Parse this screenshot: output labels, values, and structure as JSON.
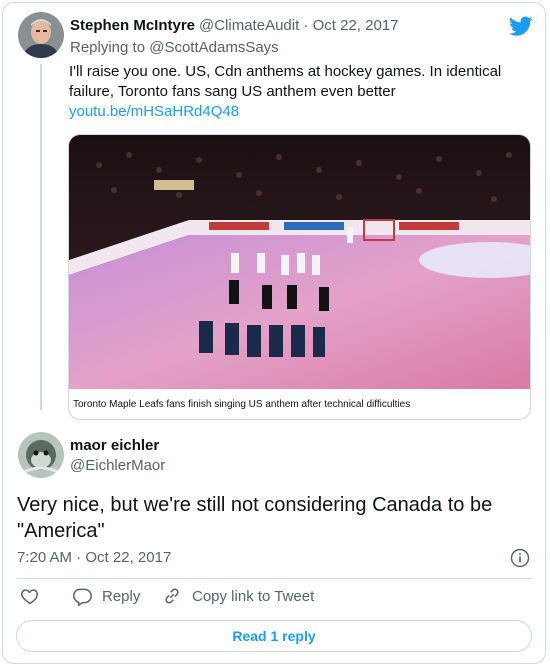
{
  "quoted_tweet": {
    "author_name": "Stephen McIntyre",
    "handle": "@ClimateAudit",
    "separator": "·",
    "date": "Oct 22, 2017",
    "reply_prefix": "Replying to",
    "reply_to": "@ScottAdamsSays",
    "text_line1": "I'll raise you one. US, Cdn anthems at hockey games. In identical",
    "text_line2": "failure, Toronto fans sang US anthem even better",
    "link": "youtu.be/mHSaHRd4Q48",
    "media_caption": "Toronto Maple Leafs fans finish singing US anthem after technical difficulties"
  },
  "main_tweet": {
    "author_name": "maor eichler",
    "handle": "@EichlerMaor",
    "text_line1": "Very nice, but we're still not considering Canada to be",
    "text_line2": "\"America\"",
    "time": "7:20 AM",
    "separator": "·",
    "date": "Oct 22, 2017"
  },
  "actions": {
    "reply_label": "Reply",
    "copy_link_label": "Copy link to Tweet"
  },
  "read_replies_label": "Read 1 reply",
  "icons": {
    "brand": "twitter-bird-icon",
    "info": "info-icon",
    "like": "heart-icon",
    "reply": "reply-bubble-icon",
    "copy": "link-icon"
  },
  "colors": {
    "accent": "#1d9bf0",
    "muted": "#536471",
    "border": "#cfd9de"
  }
}
